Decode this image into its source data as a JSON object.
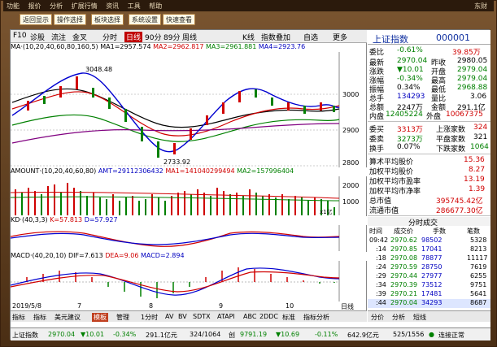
{
  "topbar": {
    "items": [
      "功能",
      "报价",
      "分析",
      "扩展行情",
      "资讯",
      "工具",
      "帮助"
    ]
  },
  "buttons": [
    "返回显示",
    "操作选择",
    "板块选择",
    "系统设置",
    "快速查看"
  ],
  "right_logo": "东财",
  "toolbar": {
    "f10": "F10",
    "dj": "诊股",
    "lc": "流注",
    "jx": "金叉",
    "fenshi": "分时",
    "rixian": "日线",
    "m90": "90分",
    "m89": "89分",
    "zhouxian": "周线",
    "kline": "K线",
    "zhibiao": "指数叠加",
    "zixuan": "自选",
    "gengduo": "更多"
  },
  "ma_line": {
    "label": "MA·(10,20,40,60,80,160,5)",
    "ma1": "MA1=2957.574",
    "ma2": "MA2=2962.817",
    "ma3": "MA3=2961.881",
    "ma4": "MA4=2923.76"
  },
  "price_axis": [
    "3000",
    "2900",
    "2800"
  ],
  "price_high_label": "3048.48",
  "price_low_label": "2733.92",
  "amount_label": {
    "label": "AMOUNT·(10,20,40,60,80)",
    "amt": "AMT=29112306432",
    "ma1": "MA1=141040299494",
    "ma2": "MA2=157996404",
    "unit": "x1亿"
  },
  "amount_axis": [
    "2000",
    "1000"
  ],
  "kd_label": {
    "label": "KD·(40,3,3)",
    "k": "K=57.813",
    "d": "D=57.927"
  },
  "macd_label": {
    "label": "MACD·(40,20,10)",
    "dif": "DIF=7.613",
    "dea": "DEA=9.06",
    "macd": "MACD=2.894"
  },
  "date_axis": {
    "start": "2019/5/8",
    "m7": "7",
    "m8": "8",
    "m9": "9",
    "m10": "10",
    "rixian": "日线"
  },
  "bottom_tabs": [
    "指标",
    "指标",
    "美元建议",
    "模板",
    "管理",
    "1分时",
    "AV",
    "BV",
    "SDTX",
    "ATAPI",
    "ABC",
    "2DDC",
    "标准",
    "指标分析"
  ],
  "index": {
    "name": "上证指数",
    "code": "000001"
  },
  "quotes": [
    {
      "l1": "委比",
      "v1": "-0.61%",
      "l2": "",
      "v2": "39.85万"
    },
    {
      "l1": "最新",
      "v1": "2970.04",
      "l2": "昨收",
      "v2": "2980.05"
    },
    {
      "l1": "涨跌",
      "v1": "▼10.01",
      "l2": "开盘",
      "v2": "2979.04"
    },
    {
      "l1": "涨幅",
      "v1": "-0.34%",
      "l2": "最高",
      "v2": "2979.04"
    },
    {
      "l1": "振幅",
      "v1": "0.34%",
      "l2": "最低",
      "v2": "2968.88"
    },
    {
      "l1": "总手",
      "v1": "134293",
      "l2": "量比",
      "v2": "3.06"
    },
    {
      "l1": "总额",
      "v1": "2247万",
      "l2": "金额",
      "v2": "291.1亿"
    },
    {
      "l1": "内盘",
      "v1": "12405224",
      "l2": "外盘",
      "v2": "10067375"
    }
  ],
  "updown": [
    {
      "l1": "委买",
      "v1": "3313万",
      "l2": "上涨家数",
      "v2": "324"
    },
    {
      "l1": "委卖",
      "v1": "3273万",
      "l2": "平盘家数",
      "v2": "321"
    },
    {
      "l1": "换手",
      "v1": "0.07%",
      "l2": "下跌家数",
      "v2": "1064"
    }
  ],
  "stats": [
    {
      "label": "算术平均股价",
      "value": "15.36"
    },
    {
      "label": "加权平均股价",
      "value": "8.27"
    },
    {
      "label": "加权平均市盈率",
      "value": "13.19"
    },
    {
      "label": "加权平均市净率",
      "value": "1.39"
    },
    {
      "label": "总市值",
      "value": "395745.42亿"
    },
    {
      "label": "流通市值",
      "value": "286677.30亿"
    }
  ],
  "trades_header": "分时成交",
  "trades_cols": [
    "时间",
    "成交价",
    "手数",
    "笔数"
  ],
  "trades": [
    {
      "t": "09:42",
      "p": "2970.62",
      "v": "98502",
      "n": "5328"
    },
    {
      "t": ":14",
      "p": "2970.85",
      "v": "17041",
      "n": "8213"
    },
    {
      "t": ":18",
      "p": "2970.08",
      "v": "78877",
      "n": "11117"
    },
    {
      "t": ":24",
      "p": "2970.59",
      "v": "28750",
      "n": "7619"
    },
    {
      "t": ":29",
      "p": "2970.44",
      "v": "27977",
      "n": "6255"
    },
    {
      "t": ":34",
      "p": "2970.39",
      "v": "73512",
      "n": "9751"
    },
    {
      "t": ":39",
      "p": "2970.21",
      "v": "17481",
      "n": "5641"
    },
    {
      "t": ":44",
      "p": "2970.04",
      "v": "34293",
      "n": "8687"
    }
  ],
  "rtabs": [
    "分价",
    "分析",
    "短线"
  ],
  "status": {
    "name": "上证指数",
    "price": "2970.04",
    "chg": "▼10.01",
    "pct": "-0.34%",
    "amt": "291.1亿元",
    "ratio": "324/1064",
    "idx2_name": "创",
    "idx2": "9791.19",
    "chg2": "▼10.69",
    "pct2": "-0.11%",
    "amt2": "642.9亿元",
    "ratio2": "525/1556",
    "conn": "连接正常"
  },
  "colors": {
    "up": "#d00000",
    "down": "#008000",
    "ma1": "#000000",
    "ma2": "#d00000",
    "ma3": "#008000",
    "ma4": "#0000d0",
    "ma5": "#800080"
  }
}
